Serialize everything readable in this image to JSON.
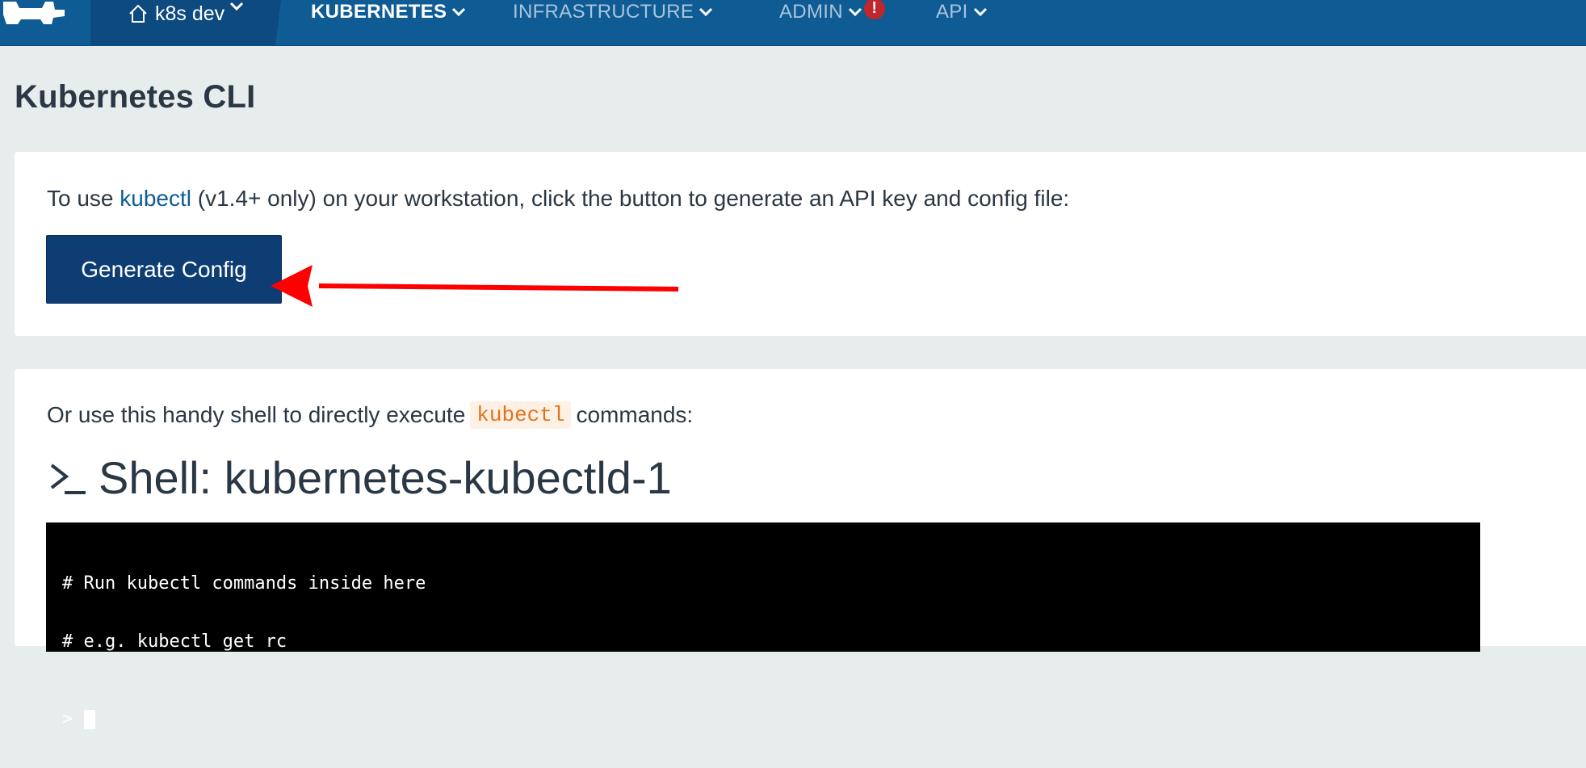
{
  "nav": {
    "environment": "k8s dev",
    "items": [
      {
        "label": "KUBERNETES",
        "active": true
      },
      {
        "label": "INFRASTRUCTURE",
        "active": false
      },
      {
        "label": "ADMIN",
        "active": false,
        "alert": "!"
      },
      {
        "label": "API",
        "active": false
      }
    ],
    "colors": {
      "bar": "#0f5c95",
      "env": "#0d4a7f",
      "alert": "#c0262c"
    }
  },
  "page": {
    "title": "Kubernetes CLI"
  },
  "config_panel": {
    "text_before": "To use ",
    "link_text": "kubectl",
    "text_after": " (v1.4+ only) on your workstation, click the button to generate an API key and config file:",
    "button_label": "Generate Config",
    "annotation": "red-arrow-icon"
  },
  "shell_panel": {
    "intro_before": "Or use this handy shell to directly execute",
    "intro_code": "kubectl",
    "intro_after": "commands:",
    "shell_title": "Shell: kubernetes-kubectld-1",
    "terminal": {
      "lines": [
        "# Run kubectl commands inside here",
        "# e.g. kubectl get rc"
      ],
      "prompt": ">"
    }
  }
}
